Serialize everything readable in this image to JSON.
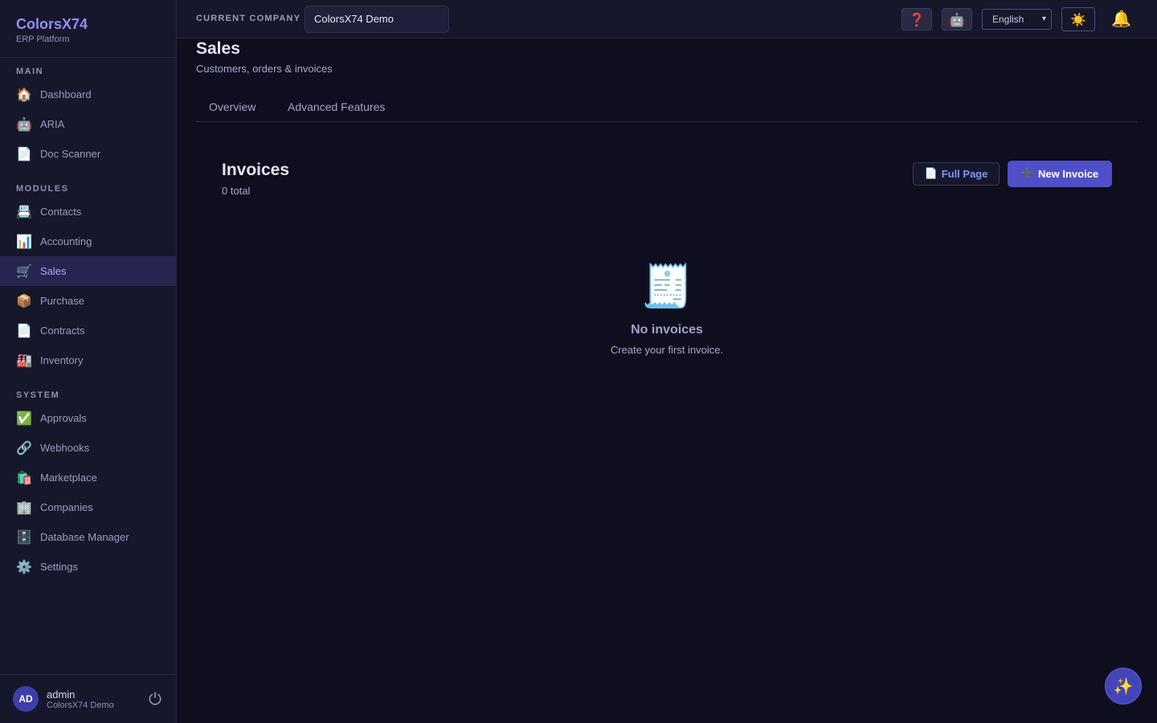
{
  "brand": {
    "name": "ColorsX74",
    "subtitle": "ERP Platform"
  },
  "sidebar": {
    "sections": [
      {
        "title": "MAIN",
        "items": [
          {
            "label": "Dashboard",
            "icon": "🏠"
          },
          {
            "label": "ARIA",
            "icon": "🤖"
          },
          {
            "label": "Doc Scanner",
            "icon": "📄"
          }
        ]
      },
      {
        "title": "MODULES",
        "items": [
          {
            "label": "Contacts",
            "icon": "📇"
          },
          {
            "label": "Accounting",
            "icon": "📊"
          },
          {
            "label": "Sales",
            "icon": "🛒",
            "active": true
          },
          {
            "label": "Purchase",
            "icon": "📦"
          },
          {
            "label": "Contracts",
            "icon": "📄"
          },
          {
            "label": "Inventory",
            "icon": "🏭"
          }
        ]
      },
      {
        "title": "SYSTEM",
        "items": [
          {
            "label": "Approvals",
            "icon": "✅"
          },
          {
            "label": "Webhooks",
            "icon": "🔗"
          },
          {
            "label": "Marketplace",
            "icon": "🛍️"
          },
          {
            "label": "Companies",
            "icon": "🏢"
          },
          {
            "label": "Database Manager",
            "icon": "🗄️"
          },
          {
            "label": "Settings",
            "icon": "⚙️"
          }
        ]
      }
    ]
  },
  "user": {
    "initials": "AD",
    "name": "admin",
    "company": "ColorsX74 Demo",
    "logout_icon": "⏻"
  },
  "topbar": {
    "company_label": "CURRENT COMPANY",
    "company_value": "ColorsX74 Demo",
    "help_icon": "❓",
    "bot_icon": "🤖",
    "language": "English",
    "theme_icon": "☀️",
    "bell_icon": "🔔"
  },
  "page": {
    "title": "Sales",
    "subtitle": "Customers, orders & invoices",
    "tabs": [
      {
        "label": "Overview"
      },
      {
        "label": "Advanced Features"
      }
    ]
  },
  "invoices": {
    "title": "Invoices",
    "count": "0 total",
    "full_page_icon": "📄",
    "full_page_label": "Full Page",
    "new_icon": "➕",
    "new_label": "New Invoice",
    "empty_icon": "🧾",
    "empty_title": "No invoices",
    "empty_subtitle": "Create your first invoice."
  },
  "fab_icon": "✨",
  "colors": {
    "accent": "#4f4fc9",
    "background": "#0e0e1f",
    "sidebar": "#17172b"
  }
}
